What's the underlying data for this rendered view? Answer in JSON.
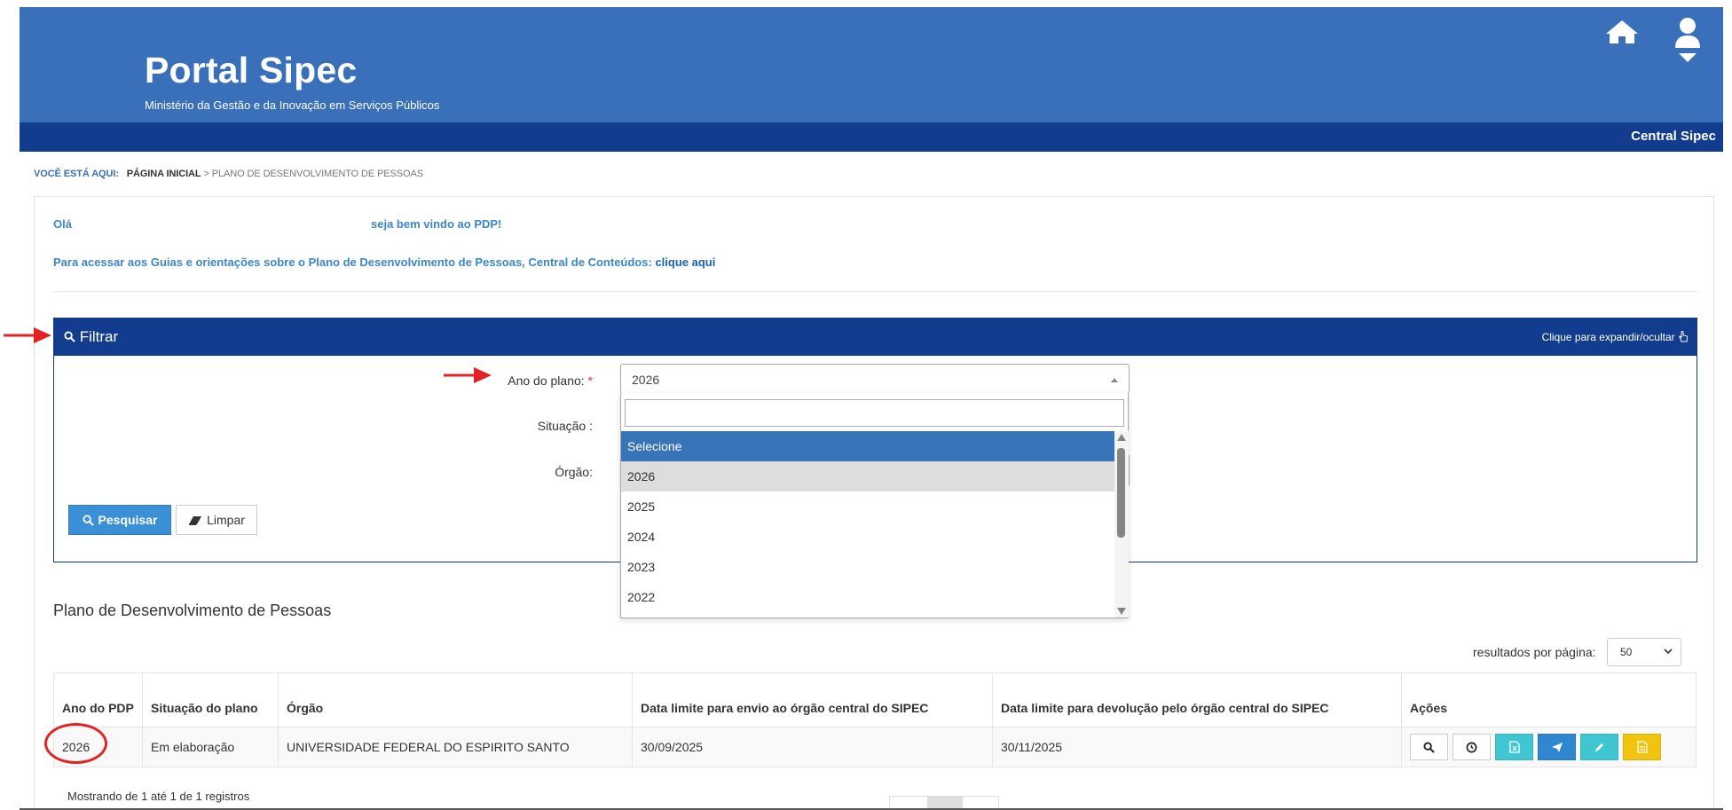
{
  "header": {
    "title": "Portal Sipec",
    "subtitle": "Ministério da Gestão e da Inovação em Serviços Públicos",
    "central_link": "Central Sipec",
    "home_icon": "home-icon",
    "user_icon": "user-icon"
  },
  "breadcrumb": {
    "label": "VOCÊ ESTÁ AQUI:",
    "home": "PÁGINA INICIAL",
    "sep": ">",
    "current": "PLANO DE DESENVOLVIMENTO DE PESSOAS"
  },
  "welcome": {
    "hello": "Olá",
    "message": "seja bem vindo ao PDP!",
    "guides_text": "Para acessar aos Guias e orientações sobre o Plano de Desenvolvimento de Pessoas, Central de Conteúdos:",
    "guides_link": "clique aqui"
  },
  "filter": {
    "title": "Filtrar",
    "toggle": "Clique para expandir/ocultar",
    "ano_label": "Ano do plano:",
    "required_mark": "*",
    "ano_value": "2026",
    "situacao_label": "Situação :",
    "orgao_label": "Órgão:",
    "search_button": "Pesquisar",
    "clear_button": "Limpar",
    "dropdown_search_placeholder": "",
    "dropdown_options": [
      "Selecione",
      "2026",
      "2025",
      "2024",
      "2023",
      "2022"
    ],
    "dropdown_highlighted": "Selecione",
    "dropdown_selected": "2026"
  },
  "table_section": {
    "title": "Plano de Desenvolvimento de Pessoas",
    "rpp_label": "resultados por página:",
    "rpp_value": "50",
    "columns": [
      "Ano do PDP",
      "Situação do plano",
      "Órgão",
      "Data limite para envio ao órgão central do SIPEC",
      "Data limite para devolução pelo órgão central do SIPEC",
      "Ações"
    ],
    "rows": [
      {
        "ano": "2026",
        "situacao": "Em elaboração",
        "orgao": "UNIVERSIDADE FEDERAL DO ESPIRITO SANTO",
        "data_envio": "30/09/2025",
        "data_devolucao": "30/11/2025"
      }
    ],
    "footer_info": "Mostrando de 1 até 1 de 1 registros"
  },
  "colors": {
    "header_blue": "#3970b9",
    "dark_blue": "#123d8f",
    "accent_blue": "#3b8fd6",
    "link_blue": "#3a86c8",
    "annotation_red": "#e02424"
  }
}
